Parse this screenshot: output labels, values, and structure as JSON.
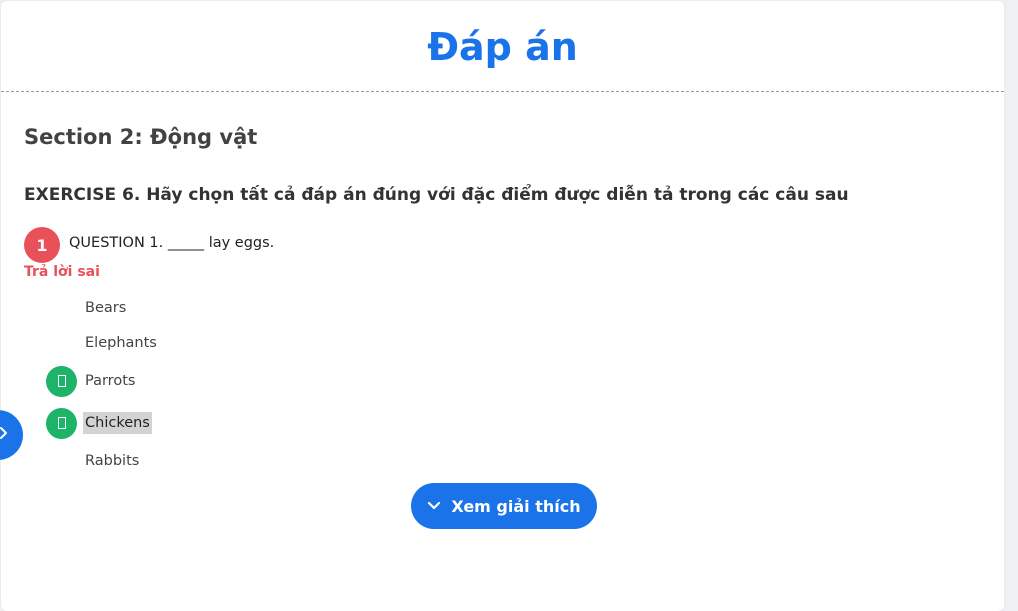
{
  "header": {
    "title": "Đáp án"
  },
  "section": {
    "title": "Section 2: Động vật"
  },
  "exercise": {
    "title": "EXERCISE 6. Hãy chọn tất cả đáp án đúng với đặc điểm được diễn tả trong các câu sau"
  },
  "question": {
    "number": "1",
    "text": "QUESTION 1. _____ lay eggs.",
    "result": "Trả lời sai",
    "result_color": "#e8515a",
    "options": [
      {
        "label": "Bears",
        "correct": false,
        "selected": false
      },
      {
        "label": "Elephants",
        "correct": false,
        "selected": false
      },
      {
        "label": "Parrots",
        "correct": true,
        "selected": false
      },
      {
        "label": "Chickens",
        "correct": true,
        "selected": true
      },
      {
        "label": "Rabbits",
        "correct": false,
        "selected": false
      }
    ]
  },
  "actions": {
    "explain_label": "Xem giải thích",
    "explain_icon": "chevron-down-icon"
  },
  "side_toggle": {
    "icon": "chevron-right-icon"
  },
  "colors": {
    "primary": "#1a73e8",
    "correct": "#1db469",
    "wrong": "#e8515a"
  }
}
